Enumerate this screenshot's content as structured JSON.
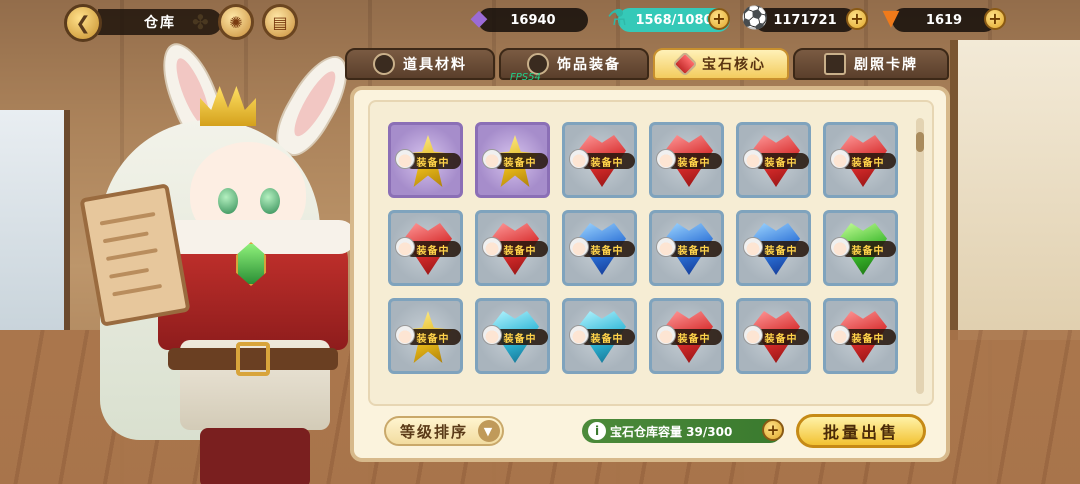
{
  "header": {
    "title": "仓库",
    "back_icon": "back-arrow-icon",
    "shortcut_icons": [
      "clover-icon",
      "compass-icon",
      "book-icon"
    ]
  },
  "resources": {
    "crystal": {
      "value": "16940",
      "icon": "purple-crystal-icon"
    },
    "energy": {
      "value": "1568/1080",
      "icon": "potion-icon",
      "color": "#35c9b8"
    },
    "coins": {
      "value": "1171721",
      "icon": "soccer-ball-icon"
    },
    "carrots": {
      "value": "1619",
      "icon": "carrot-icon"
    }
  },
  "tabs": [
    {
      "label": "道具材料",
      "icon": "potion-bag-icon",
      "active": false
    },
    {
      "label": "饰品装备",
      "icon": "ring-icon",
      "active": false
    },
    {
      "label": "宝石核心",
      "icon": "red-gem-icon",
      "active": true
    },
    {
      "label": "剧照卡牌",
      "icon": "card-icon",
      "active": false
    }
  ],
  "overlay": {
    "fps": "FPS54"
  },
  "gems": [
    {
      "color": "yellow",
      "frame": "purple",
      "tag": "装备中"
    },
    {
      "color": "yellow",
      "frame": "purple",
      "tag": "装备中"
    },
    {
      "color": "red",
      "frame": "blue",
      "tag": "装备中"
    },
    {
      "color": "red",
      "frame": "blue",
      "tag": "装备中"
    },
    {
      "color": "red",
      "frame": "blue",
      "tag": "装备中"
    },
    {
      "color": "red",
      "frame": "blue",
      "tag": "装备中"
    },
    {
      "color": "red",
      "frame": "blue",
      "tag": "装备中"
    },
    {
      "color": "red",
      "frame": "blue",
      "tag": "装备中"
    },
    {
      "color": "blue",
      "frame": "blue",
      "tag": "装备中"
    },
    {
      "color": "blue",
      "frame": "blue",
      "tag": "装备中"
    },
    {
      "color": "blue",
      "frame": "blue",
      "tag": "装备中"
    },
    {
      "color": "green",
      "frame": "blue",
      "tag": "装备中"
    },
    {
      "color": "yellow",
      "frame": "blue",
      "tag": "装备中"
    },
    {
      "color": "cyan",
      "frame": "blue",
      "tag": "装备中"
    },
    {
      "color": "cyan",
      "frame": "blue",
      "tag": "装备中"
    },
    {
      "color": "red",
      "frame": "blue",
      "tag": "装备中"
    },
    {
      "color": "red",
      "frame": "blue",
      "tag": "装备中"
    },
    {
      "color": "red",
      "frame": "blue",
      "tag": "装备中"
    }
  ],
  "footer": {
    "sort_label": "等级排序",
    "capacity_label": "宝石仓库容量 39/300",
    "sell_label": "批量出售"
  }
}
